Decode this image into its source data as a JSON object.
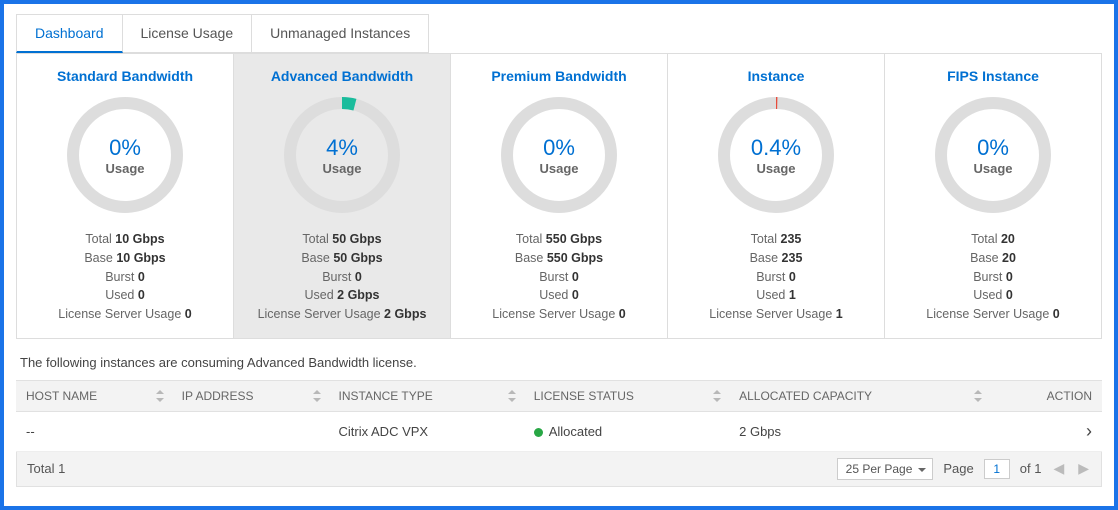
{
  "tabs": [
    {
      "label": "Dashboard",
      "active": true
    },
    {
      "label": "License Usage",
      "active": false
    },
    {
      "label": "Unmanaged Instances",
      "active": false
    }
  ],
  "chart_data": [
    {
      "type": "pie",
      "title": "Standard Bandwidth",
      "percent": 0,
      "values": [
        0,
        100
      ],
      "categories": [
        "Used",
        "Remaining"
      ],
      "color": "#1abc9c"
    },
    {
      "type": "pie",
      "title": "Advanced Bandwidth",
      "percent": 4,
      "values": [
        4,
        96
      ],
      "categories": [
        "Used",
        "Remaining"
      ],
      "color": "#1abc9c"
    },
    {
      "type": "pie",
      "title": "Premium Bandwidth",
      "percent": 0,
      "values": [
        0,
        100
      ],
      "categories": [
        "Used",
        "Remaining"
      ],
      "color": "#1abc9c"
    },
    {
      "type": "pie",
      "title": "Instance",
      "percent": 0.4,
      "values": [
        0.4,
        99.6
      ],
      "categories": [
        "Used",
        "Remaining"
      ],
      "color": "#e74c3c"
    },
    {
      "type": "pie",
      "title": "FIPS Instance",
      "percent": 0,
      "values": [
        0,
        100
      ],
      "categories": [
        "Used",
        "Remaining"
      ],
      "color": "#1abc9c"
    }
  ],
  "cards": [
    {
      "title": "Standard Bandwidth",
      "pct": "0%",
      "usage_label": "Usage",
      "selected": false,
      "stats": {
        "total_lbl": "Total",
        "total": "10 Gbps",
        "base_lbl": "Base",
        "base": "10 Gbps",
        "burst_lbl": "Burst",
        "burst": "0",
        "used_lbl": "Used",
        "used": "0",
        "lsu_lbl": "License Server Usage",
        "lsu": "0"
      }
    },
    {
      "title": "Advanced Bandwidth",
      "pct": "4%",
      "usage_label": "Usage",
      "selected": true,
      "stats": {
        "total_lbl": "Total",
        "total": "50 Gbps",
        "base_lbl": "Base",
        "base": "50 Gbps",
        "burst_lbl": "Burst",
        "burst": "0",
        "used_lbl": "Used",
        "used": "2 Gbps",
        "lsu_lbl": "License Server Usage",
        "lsu": "2 Gbps"
      }
    },
    {
      "title": "Premium Bandwidth",
      "pct": "0%",
      "usage_label": "Usage",
      "selected": false,
      "stats": {
        "total_lbl": "Total",
        "total": "550 Gbps",
        "base_lbl": "Base",
        "base": "550 Gbps",
        "burst_lbl": "Burst",
        "burst": "0",
        "used_lbl": "Used",
        "used": "0",
        "lsu_lbl": "License Server Usage",
        "lsu": "0"
      }
    },
    {
      "title": "Instance",
      "pct": "0.4%",
      "usage_label": "Usage",
      "selected": false,
      "stats": {
        "total_lbl": "Total",
        "total": "235",
        "base_lbl": "Base",
        "base": "235",
        "burst_lbl": "Burst",
        "burst": "0",
        "used_lbl": "Used",
        "used": "1",
        "lsu_lbl": "License Server Usage",
        "lsu": "1"
      }
    },
    {
      "title": "FIPS Instance",
      "pct": "0%",
      "usage_label": "Usage",
      "selected": false,
      "stats": {
        "total_lbl": "Total",
        "total": "20",
        "base_lbl": "Base",
        "base": "20",
        "burst_lbl": "Burst",
        "burst": "0",
        "used_lbl": "Used",
        "used": "0",
        "lsu_lbl": "License Server Usage",
        "lsu": "0"
      }
    }
  ],
  "description": "The following instances are consuming Advanced Bandwidth license.",
  "table": {
    "headers": [
      "HOST NAME",
      "IP ADDRESS",
      "INSTANCE TYPE",
      "LICENSE STATUS",
      "ALLOCATED CAPACITY",
      "ACTION"
    ],
    "rows": [
      {
        "host": "--",
        "ip": "",
        "type": "Citrix ADC VPX",
        "status": "Allocated",
        "capacity": "2 Gbps"
      }
    ]
  },
  "footer": {
    "total_label": "Total",
    "total_value": "1",
    "per_page": "25 Per Page",
    "page_label": "Page",
    "page_value": "1",
    "of_label": "of 1"
  }
}
